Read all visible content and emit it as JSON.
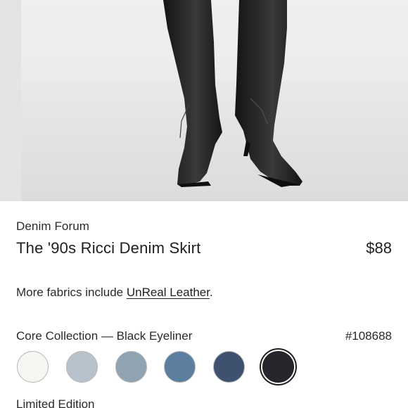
{
  "product": {
    "brand": "Denim Forum",
    "title": "The '90s Ricci Denim Skirt",
    "price": "$88"
  },
  "fabrics": {
    "prefix": "More fabrics include ",
    "link": "UnReal Leather",
    "suffix": "."
  },
  "collection": {
    "label": "Core Collection — Black Eyeliner",
    "sku": "#108688"
  },
  "swatches": [
    {
      "name": "cream",
      "color": "#f6f5f1"
    },
    {
      "name": "light-wash",
      "color": "#b8c2cc"
    },
    {
      "name": "slate-blue",
      "color": "#8fa3b0"
    },
    {
      "name": "mid-blue",
      "color": "#5d7f9f"
    },
    {
      "name": "dark-navy",
      "color": "#3e5270"
    },
    {
      "name": "black-eyeliner",
      "color": "#25272d",
      "selected": true
    }
  ],
  "limited": {
    "label": "Limited Edition"
  },
  "hero": {
    "image": "black leather knee-high boots photo"
  }
}
